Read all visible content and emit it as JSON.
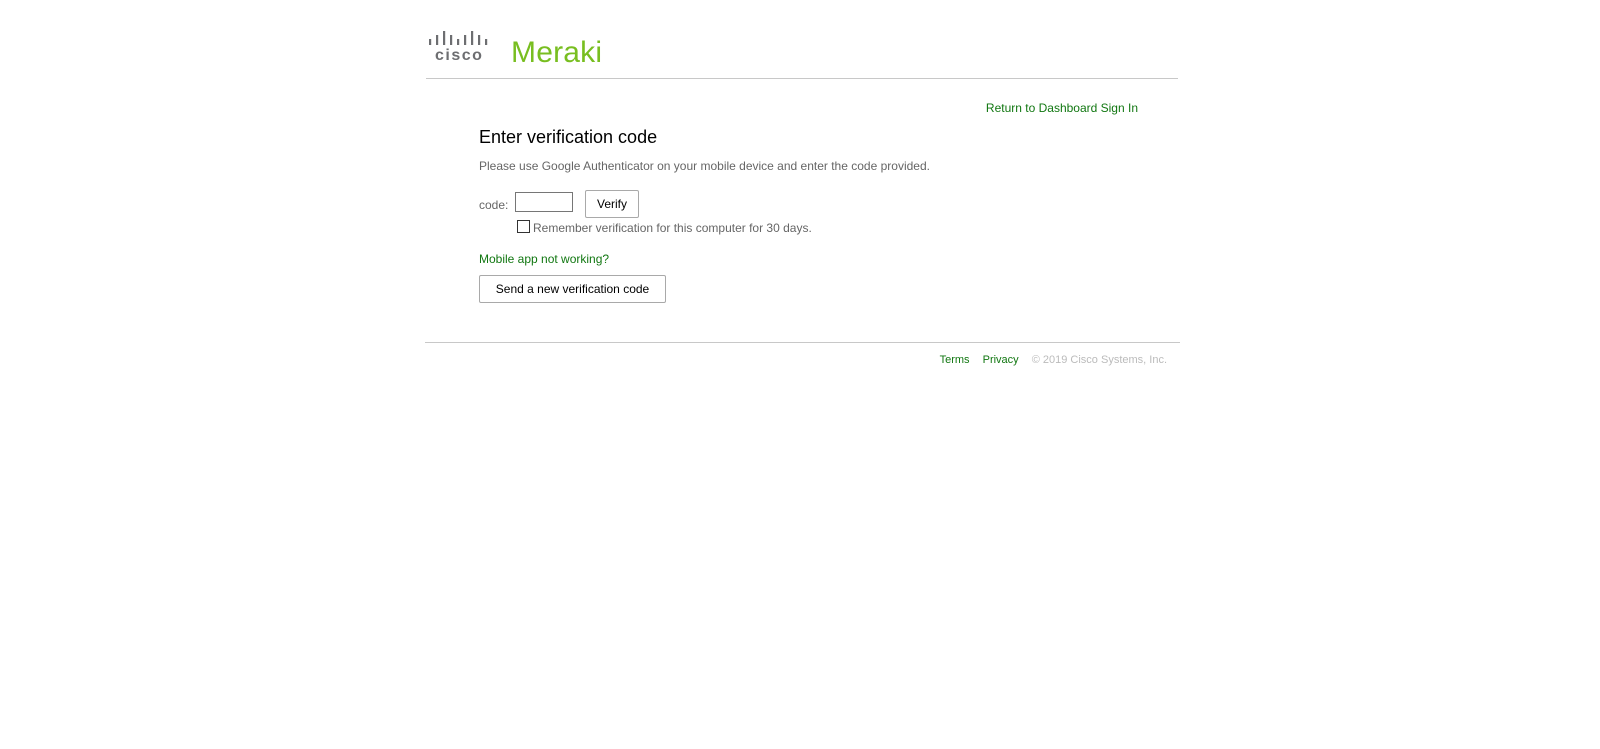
{
  "header": {
    "cisco_logo_text": "cisco",
    "meraki_logo_text": "Meraki",
    "logo_color": "#78be20"
  },
  "return_link": "Return to Dashboard Sign In",
  "verification": {
    "title": "Enter verification code",
    "description": "Please use Google Authenticator on your mobile device and enter the code provided.",
    "code_label": "code:",
    "code_value": "",
    "verify_button": "Verify",
    "remember_checked": false,
    "remember_label": "Remember verification for this computer for 30 days.",
    "mobile_link": "Mobile app not working?",
    "send_button": "Send a new verification code"
  },
  "footer": {
    "terms": "Terms",
    "privacy": "Privacy",
    "copyright": "© 2019 Cisco Systems, Inc."
  },
  "colors": {
    "link": "#117711",
    "muted_text": "#666666"
  }
}
